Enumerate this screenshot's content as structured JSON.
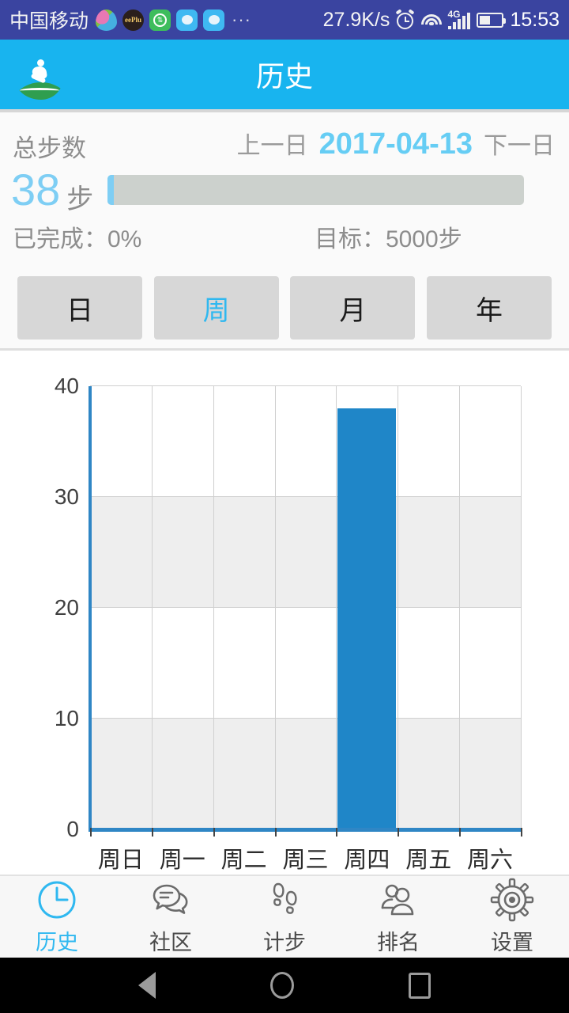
{
  "status_bar": {
    "carrier": "中国移动",
    "net_speed": "27.9K/s",
    "time": "15:53",
    "signal_tech": "4G",
    "icons": [
      "app-leaf-icon",
      "eeplu-icon",
      "green-sync-icon",
      "chat-icon",
      "chat-icon",
      "more-dots-icon"
    ],
    "overflow_dots": "···",
    "background": "#3a44a0"
  },
  "app_bar": {
    "title": "历史",
    "logo_name": "app-logo",
    "background": "#18b4ef"
  },
  "summary": {
    "total_label": "总步数",
    "prev_day": "上一日",
    "date": "2017-04-13",
    "next_day": "下一日",
    "steps_value": "38",
    "steps_unit": "步",
    "progress_percent": 0,
    "completed_label": "已完成：0%",
    "goal_label": "目标：5000步",
    "accent": "#7ecef4"
  },
  "period_tabs": [
    {
      "label": "日",
      "active": false
    },
    {
      "label": "周",
      "active": true
    },
    {
      "label": "月",
      "active": false
    },
    {
      "label": "年",
      "active": false
    }
  ],
  "chart_data": {
    "type": "bar",
    "title": "",
    "xlabel": "",
    "ylabel": "",
    "categories": [
      "周日",
      "周一",
      "周二",
      "周三",
      "周四",
      "周五",
      "周六"
    ],
    "values": [
      0,
      0,
      0,
      0,
      38,
      0,
      0
    ],
    "ylim": [
      0,
      40
    ],
    "yticks": [
      0,
      10,
      20,
      30,
      40
    ],
    "ytick_labels": [
      "0",
      "10",
      "20",
      "30",
      "40"
    ],
    "grid": true,
    "legend": null,
    "bar_color": "#1f86c8",
    "axis_color": "#2f86c5",
    "band_colors": [
      "#ffffff",
      "#eeeeee"
    ]
  },
  "bottom_nav": [
    {
      "label": "历史",
      "icon": "clock-icon",
      "active": true
    },
    {
      "label": "社区",
      "icon": "chat-bubbles-icon",
      "active": false
    },
    {
      "label": "计步",
      "icon": "footprints-icon",
      "active": false
    },
    {
      "label": "排名",
      "icon": "people-icon",
      "active": false
    },
    {
      "label": "设置",
      "icon": "gear-icon",
      "active": false
    }
  ],
  "android_nav": {
    "back": "back-icon",
    "home": "home-icon",
    "recents": "recents-icon"
  }
}
